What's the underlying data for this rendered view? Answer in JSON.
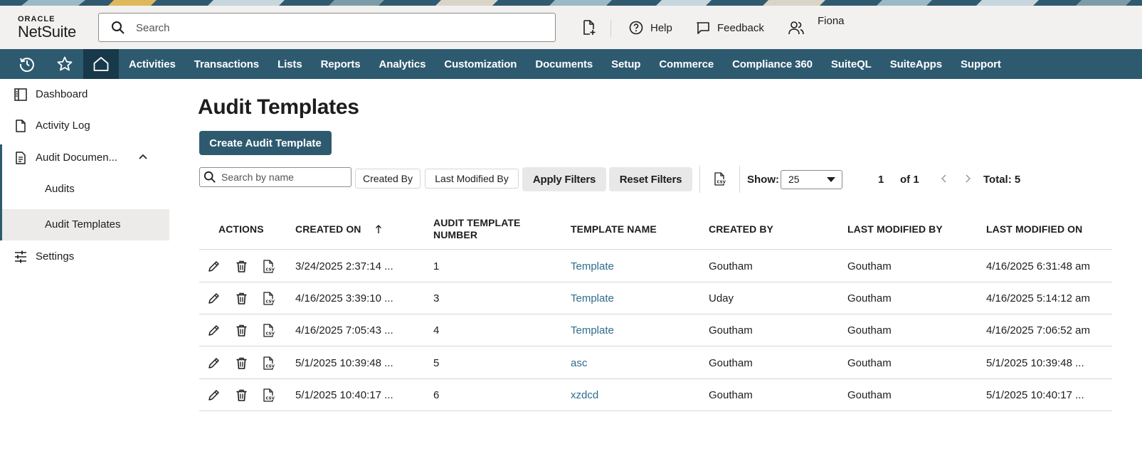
{
  "header": {
    "logo_top": "ORACLE",
    "logo_bottom": "NetSuite",
    "search_placeholder": "Search",
    "help_label": "Help",
    "feedback_label": "Feedback",
    "user_name": "Fiona"
  },
  "navbar": {
    "items": [
      "Activities",
      "Transactions",
      "Lists",
      "Reports",
      "Analytics",
      "Customization",
      "Documents",
      "Setup",
      "Commerce",
      "Compliance 360",
      "SuiteQL",
      "SuiteApps",
      "Support"
    ]
  },
  "sidebar": {
    "dashboard": "Dashboard",
    "activity_log": "Activity Log",
    "audit_documents": "Audit Documen...",
    "audits": "Audits",
    "audit_templates": "Audit Templates",
    "settings": "Settings"
  },
  "main": {
    "title": "Audit Templates",
    "create_button": "Create Audit Template",
    "filter_search_placeholder": "Search by name",
    "filter_created_by": "Created By",
    "filter_last_modified_by": "Last Modified By",
    "apply_filters": "Apply Filters",
    "reset_filters": "Reset Filters",
    "show_label": "Show:",
    "show_value": "25",
    "page_number": "1",
    "page_of": "of 1",
    "total": "Total: 5"
  },
  "table": {
    "headers": {
      "actions": "ACTIONS",
      "created_on": "CREATED ON",
      "number_line1": "AUDIT TEMPLATE",
      "number_line2": "NUMBER",
      "template_name": "TEMPLATE NAME",
      "created_by": "CREATED BY",
      "last_modified_by": "LAST MODIFIED BY",
      "last_modified_on": "LAST MODIFIED ON"
    },
    "rows": [
      {
        "created_on": "3/24/2025 2:37:14 ...",
        "number": "1",
        "name": "Template",
        "created_by": "Goutham",
        "modified_by": "Goutham",
        "modified_on": "4/16/2025 6:31:48 am"
      },
      {
        "created_on": "4/16/2025 3:39:10 ...",
        "number": "3",
        "name": "Template",
        "created_by": "Uday",
        "modified_by": "Goutham",
        "modified_on": "4/16/2025 5:14:12 am"
      },
      {
        "created_on": "4/16/2025 7:05:43 ...",
        "number": "4",
        "name": "Template",
        "created_by": "Goutham",
        "modified_by": "Goutham",
        "modified_on": "4/16/2025 7:06:52 am"
      },
      {
        "created_on": "5/1/2025 10:39:48 ...",
        "number": "5",
        "name": "asc",
        "created_by": "Goutham",
        "modified_by": "Goutham",
        "modified_on": "5/1/2025 10:39:48 ..."
      },
      {
        "created_on": "5/1/2025 10:40:17 ...",
        "number": "6",
        "name": "xzdcd",
        "created_by": "Goutham",
        "modified_by": "Goutham",
        "modified_on": "5/1/2025 10:40:17 ..."
      }
    ]
  },
  "colors": {
    "brand_nav": "#2e5a70",
    "nav_home": "#18394a",
    "link": "#2e6c8c"
  },
  "icons": {
    "recent": "history-icon",
    "favorites": "star-icon",
    "home": "home-icon",
    "edit": "pencil-icon",
    "delete": "trash-icon",
    "csv": "csv-file-icon"
  }
}
